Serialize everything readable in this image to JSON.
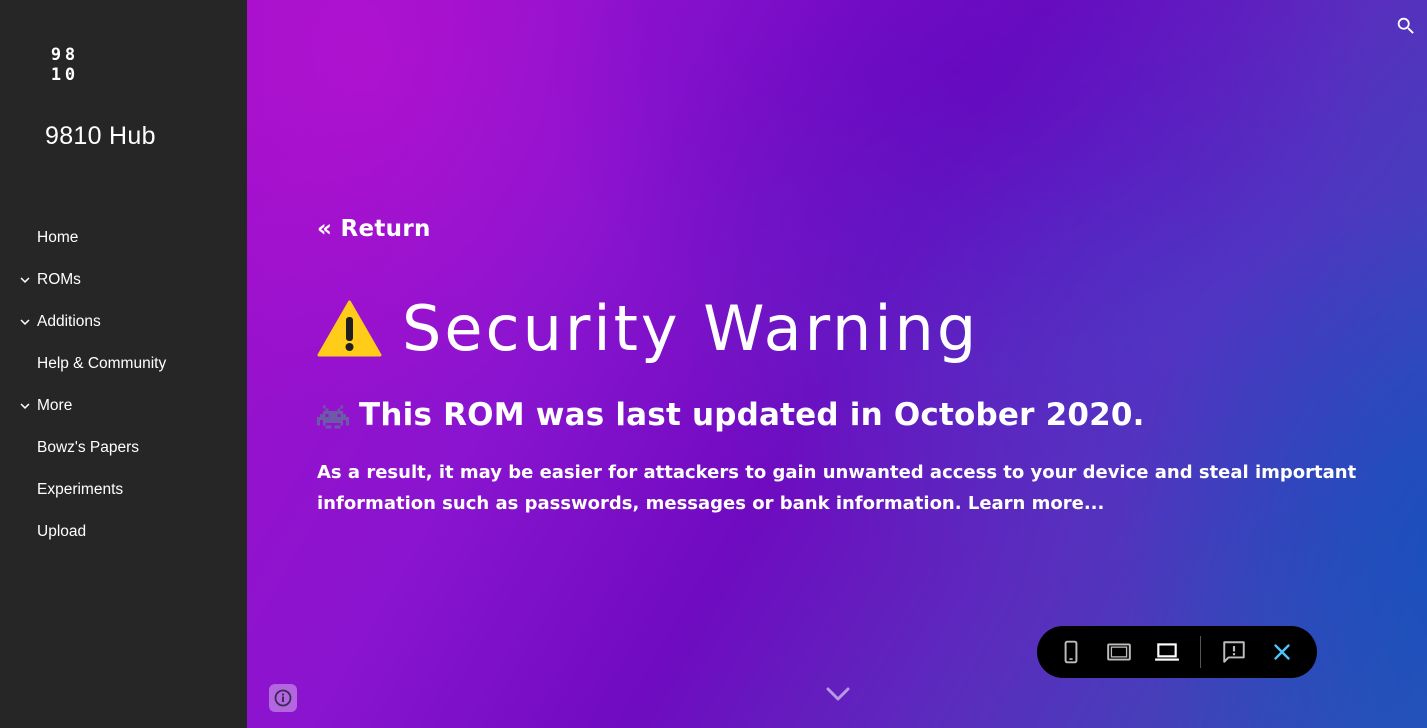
{
  "sidebar": {
    "logo": {
      "top_left": "9",
      "top_right": "8",
      "bottom_left": "1",
      "bottom_right": "0"
    },
    "site_title": "9810 Hub",
    "items": [
      {
        "label": "Home",
        "expandable": false
      },
      {
        "label": "ROMs",
        "expandable": true
      },
      {
        "label": "Additions",
        "expandable": true
      },
      {
        "label": "Help & Community",
        "expandable": false
      },
      {
        "label": "More",
        "expandable": true
      },
      {
        "label": "Bowz's Papers",
        "expandable": false
      },
      {
        "label": "Experiments",
        "expandable": false
      },
      {
        "label": "Upload",
        "expandable": false
      }
    ]
  },
  "main": {
    "return_label": "« Return",
    "headline": "Security Warning",
    "headline_icon": "warning-icon",
    "subheadline": "This ROM was last updated in October 2020.",
    "subheadline_icon": "space-invader-icon",
    "body": "As a result, it may be easier for attackers to gain unwanted access to your device and steal important information such as passwords, messages or bank information. Learn more..."
  },
  "device_bar": {
    "buttons": [
      "phone-preview-icon",
      "tablet-preview-icon",
      "laptop-preview-icon",
      "feedback-icon",
      "close-icon"
    ],
    "active": "laptop-preview-icon",
    "accent_color": "#4fc3f7"
  },
  "colors": {
    "sidebar_bg": "#262626",
    "gradient_start": "#a10fcb",
    "gradient_end": "#2d55b6"
  }
}
